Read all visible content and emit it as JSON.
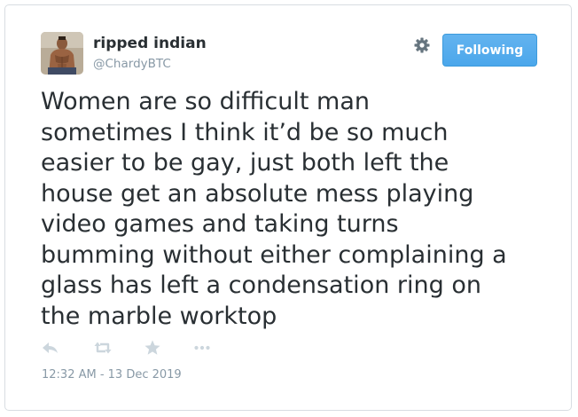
{
  "user": {
    "display_name": "ripped indian",
    "handle": "@ChardyBTC",
    "avatar_icon": "user-avatar-photo"
  },
  "header": {
    "settings_icon": "gear-icon",
    "follow_label": "Following"
  },
  "tweet": {
    "text": "Women are so difficult man\nsometimes I think it’d be so much\neasier to be gay, just both left the\nhouse get an absolute mess playing\nvideo games and taking turns\nbumming without either complaining a\nglass has left a condensation ring on\nthe marble worktop"
  },
  "actions": [
    {
      "icon": "reply-icon"
    },
    {
      "icon": "retweet-icon"
    },
    {
      "icon": "favorite-star-icon"
    },
    {
      "icon": "more-dots-icon"
    }
  ],
  "meta": {
    "timestamp": "12:32 AM - 13 Dec 2019"
  },
  "colors": {
    "accent": "#55acee",
    "text": "#292f33",
    "muted": "#8899a6",
    "icon": "#ccd6dd"
  }
}
